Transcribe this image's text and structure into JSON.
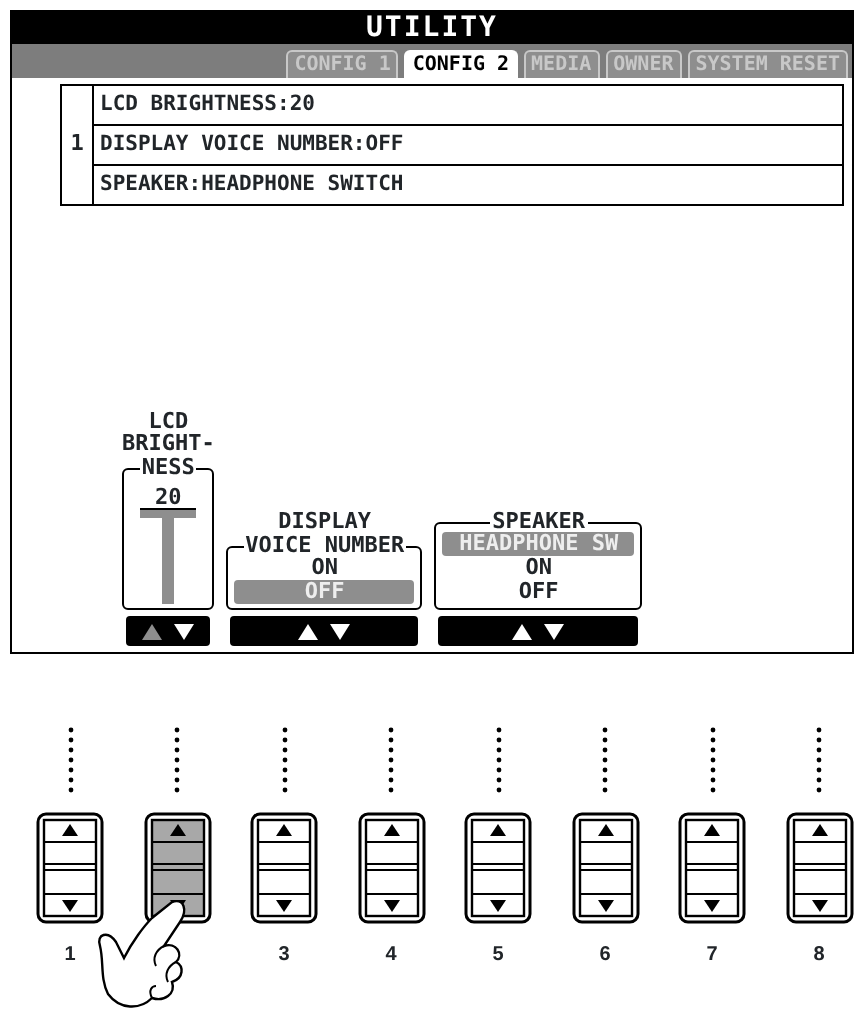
{
  "screen": {
    "title": "UTILITY",
    "tabs": [
      {
        "label": "CONFIG 1",
        "selected": false
      },
      {
        "label": "CONFIG 2",
        "selected": true
      },
      {
        "label": "MEDIA",
        "selected": false
      },
      {
        "label": "OWNER",
        "selected": false
      },
      {
        "label": "SYSTEM RESET",
        "selected": false
      }
    ],
    "list": {
      "number": "1",
      "items": [
        "LCD BRIGHTNESS:20",
        "DISPLAY VOICE NUMBER:OFF",
        "SPEAKER:HEADPHONE SWITCH"
      ]
    },
    "controls": [
      {
        "kind": "slider",
        "title_lines": [
          "LCD",
          "BRIGHT-",
          "NESS"
        ],
        "value": "20",
        "up_enabled": false,
        "down_enabled": true
      },
      {
        "kind": "options",
        "title_lines": [
          "DISPLAY",
          "VOICE NUMBER"
        ],
        "options": [
          {
            "label": "ON",
            "selected": false
          },
          {
            "label": "OFF",
            "selected": true
          }
        ],
        "up_enabled": true,
        "down_enabled": true
      },
      {
        "kind": "options",
        "title_lines": [
          "SPEAKER"
        ],
        "options": [
          {
            "label": "HEADPHONE SW",
            "selected": true
          },
          {
            "label": "ON",
            "selected": false
          },
          {
            "label": "OFF",
            "selected": false
          }
        ],
        "up_enabled": true,
        "down_enabled": true
      }
    ]
  },
  "panel_buttons": [
    {
      "label": "1",
      "pressed": false
    },
    {
      "pressed": true
    },
    {
      "label": "3",
      "pressed": false
    },
    {
      "label": "4",
      "pressed": false
    },
    {
      "label": "5",
      "pressed": false
    },
    {
      "label": "6",
      "pressed": false
    },
    {
      "label": "7",
      "pressed": false
    },
    {
      "label": "8",
      "pressed": false
    }
  ]
}
